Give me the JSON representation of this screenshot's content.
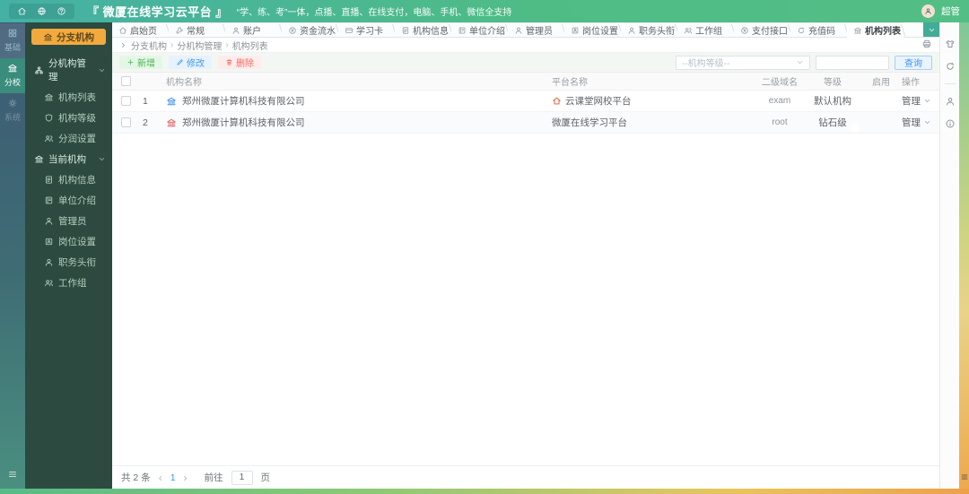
{
  "header": {
    "title": "『 微厦在线学习云平台 』",
    "subtitle": "“学、练、考”一体，点播、直播、在线支付，电脑、手机、微信全支持",
    "user": "超管"
  },
  "rail": {
    "items": [
      {
        "label": "基础"
      },
      {
        "label": "分校"
      },
      {
        "label": "系统"
      }
    ]
  },
  "sidebar": {
    "org_button": "分支机构",
    "group1": {
      "label": "分机构管理",
      "items": [
        {
          "label": "机构列表"
        },
        {
          "label": "机构等级"
        },
        {
          "label": "分润设置"
        }
      ]
    },
    "group2": {
      "label": "当前机构",
      "items": [
        {
          "label": "机构信息"
        },
        {
          "label": "单位介绍"
        },
        {
          "label": "管理员"
        },
        {
          "label": "岗位设置"
        },
        {
          "label": "职务头衔"
        },
        {
          "label": "工作组"
        }
      ]
    }
  },
  "tabs": [
    {
      "label": "启始页"
    },
    {
      "label": "常规"
    },
    {
      "label": "账户"
    },
    {
      "label": "资金流水"
    },
    {
      "label": "学习卡"
    },
    {
      "label": "机构信息"
    },
    {
      "label": "单位介绍"
    },
    {
      "label": "管理员"
    },
    {
      "label": "岗位设置"
    },
    {
      "label": "职务头衔"
    },
    {
      "label": "工作组"
    },
    {
      "label": "支付接口"
    },
    {
      "label": "充值码"
    },
    {
      "label": "机构列表"
    }
  ],
  "breadcrumb": {
    "item1": "分支机构",
    "item2": "分机构管理",
    "item3": "机构列表"
  },
  "toolbar": {
    "add": "新增",
    "edit": "修改",
    "delete": "删除",
    "level_filter": "--机构等级--",
    "search": "查询"
  },
  "table": {
    "col_org": "机构名称",
    "col_platform": "平台名称",
    "col_domain": "二级域名",
    "col_level": "等级",
    "col_enabled": "启用",
    "col_action": "操作",
    "rows": [
      {
        "index": "1",
        "org": "郑州微厦计算机科技有限公司",
        "platform": "云课堂网校平台",
        "domain": "exam",
        "level": "默认机构",
        "enabled": true,
        "action": "管理"
      },
      {
        "index": "2",
        "org": "郑州微厦计算机科技有限公司",
        "platform": "微厦在线学习平台",
        "domain": "root",
        "level": "钻石级",
        "enabled": true,
        "action": "管理"
      }
    ]
  },
  "footer": {
    "total": "共 2 条",
    "page": "1",
    "goto_label": "前往",
    "goto_value": "1",
    "page_unit": "页"
  },
  "colors": {
    "header_gradient_left": "#45b0a4",
    "header_gradient_right": "#53be85",
    "org_button_bg": "#f2a93d",
    "sidebar_bg": "#2c4a40",
    "rail_active_bg": "#3a8c7c",
    "toggle_on": "#3da2f5",
    "accent_blue": "#3f94f0",
    "add_green": "#4ab354",
    "delete_red": "#ee6f6a",
    "row1_org_icon": "#3a8ee6",
    "row2_org_icon": "#e65b5b",
    "platform_home_icon": "#e4572e",
    "strip_orange": "#efa04a"
  }
}
